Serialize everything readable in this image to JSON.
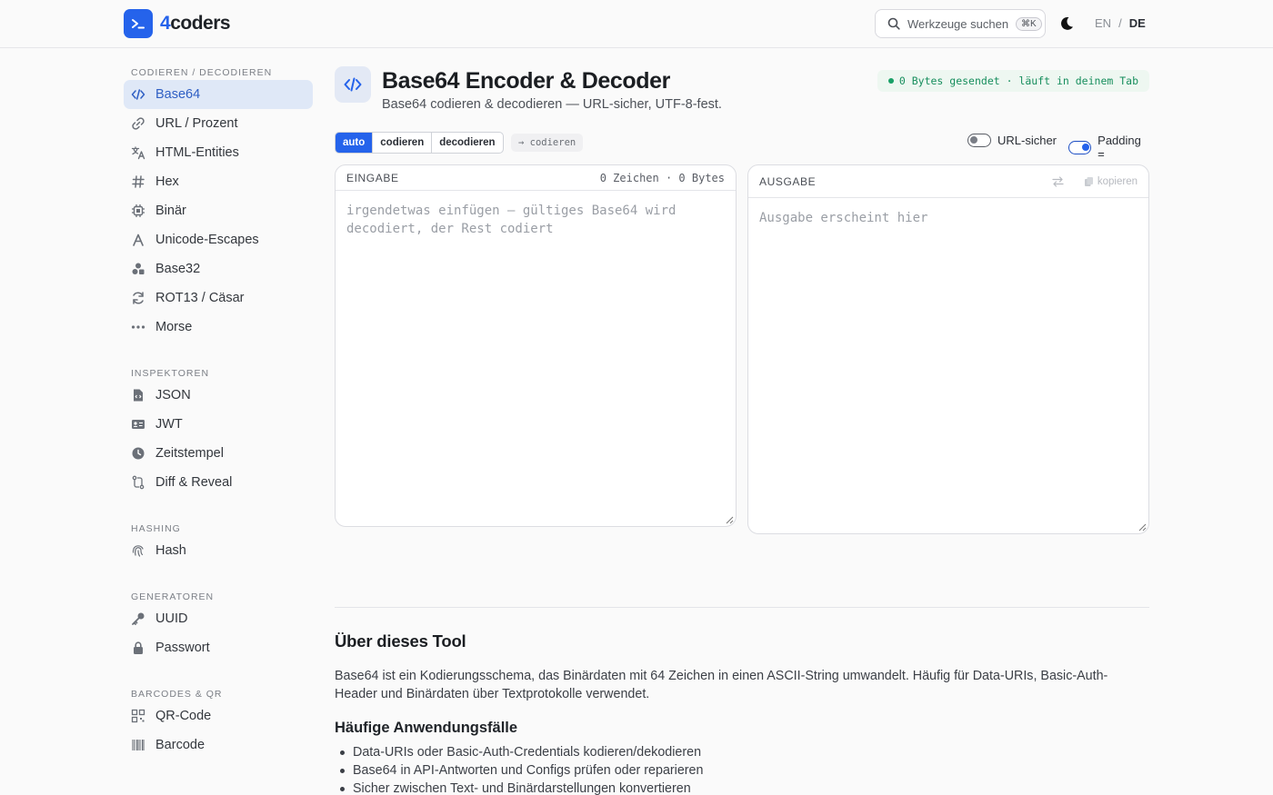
{
  "brand": {
    "prefix": "4",
    "name": "coders"
  },
  "header": {
    "search_label": "Werkzeuge suchen",
    "search_shortcut": "⌘K",
    "lang_en": "EN",
    "lang_sep": "/",
    "lang_de": "DE"
  },
  "sidebar": {
    "sections": [
      {
        "title": "CODIEREN / DECODIEREN",
        "items": [
          {
            "label": "Base64",
            "icon": "code-icon",
            "active": true
          },
          {
            "label": "URL / Prozent",
            "icon": "link-icon"
          },
          {
            "label": "HTML-Entities",
            "icon": "translate-icon"
          },
          {
            "label": "Hex",
            "icon": "hash-icon"
          },
          {
            "label": "Binär",
            "icon": "chip-icon"
          },
          {
            "label": "Unicode-Escapes",
            "icon": "letter-a-icon"
          },
          {
            "label": "Base32",
            "icon": "shapes-icon"
          },
          {
            "label": "ROT13 / Cäsar",
            "icon": "rotate-icon"
          },
          {
            "label": "Morse",
            "icon": "dots-icon"
          }
        ]
      },
      {
        "title": "INSPEKTOREN",
        "items": [
          {
            "label": "JSON",
            "icon": "json-file-icon"
          },
          {
            "label": "JWT",
            "icon": "id-card-icon"
          },
          {
            "label": "Zeitstempel",
            "icon": "clock-icon"
          },
          {
            "label": "Diff & Reveal",
            "icon": "diff-icon"
          }
        ]
      },
      {
        "title": "HASHING",
        "items": [
          {
            "label": "Hash",
            "icon": "fingerprint-icon"
          }
        ]
      },
      {
        "title": "GENERATOREN",
        "items": [
          {
            "label": "UUID",
            "icon": "key-icon"
          },
          {
            "label": "Passwort",
            "icon": "lock-icon"
          }
        ]
      },
      {
        "title": "BARCODES & QR",
        "items": [
          {
            "label": "QR-Code",
            "icon": "qr-icon"
          },
          {
            "label": "Barcode",
            "icon": "barcode-icon"
          }
        ]
      }
    ]
  },
  "tool": {
    "title": "Base64 Encoder & Decoder",
    "subtitle": "Base64 codieren & decodieren — URL-sicher, UTF-8-fest.",
    "privacy_badge": "0 Bytes gesendet · läuft in deinem Tab"
  },
  "controls": {
    "modes": [
      "auto",
      "codieren",
      "decodieren"
    ],
    "active_mode": "auto",
    "mode_hint": "→ codieren",
    "url_safe_label": "URL-sicher",
    "url_safe_on": false,
    "padding_label": "Padding =",
    "padding_on": true
  },
  "input": {
    "header": "EINGABE",
    "stats": "0 Zeichen · 0 Bytes",
    "placeholder": "irgendetwas einfügen — gültiges Base64 wird decodiert, der Rest codiert"
  },
  "output": {
    "header": "AUSGABE",
    "copy_label": "kopieren",
    "placeholder": "Ausgabe erscheint hier"
  },
  "about": {
    "title": "Über dieses Tool",
    "text": "Base64 ist ein Kodierungsschema, das Binärdaten mit 64 Zeichen in einen ASCII-String umwandelt. Häufig für Data-URIs, Basic-Auth-Header und Binärdaten über Textprotokolle verwendet.",
    "uses_title": "Häufige Anwendungsfälle",
    "uses": [
      "Data-URIs oder Basic-Auth-Credentials kodieren/dekodieren",
      "Base64 in API-Antworten und Configs prüfen oder reparieren",
      "Sicher zwischen Text- und Binärdarstellungen konvertieren"
    ]
  },
  "colors": {
    "accent": "#2563eb",
    "active_bg": "#dfe8f7",
    "privacy_green": "#178e5d"
  }
}
